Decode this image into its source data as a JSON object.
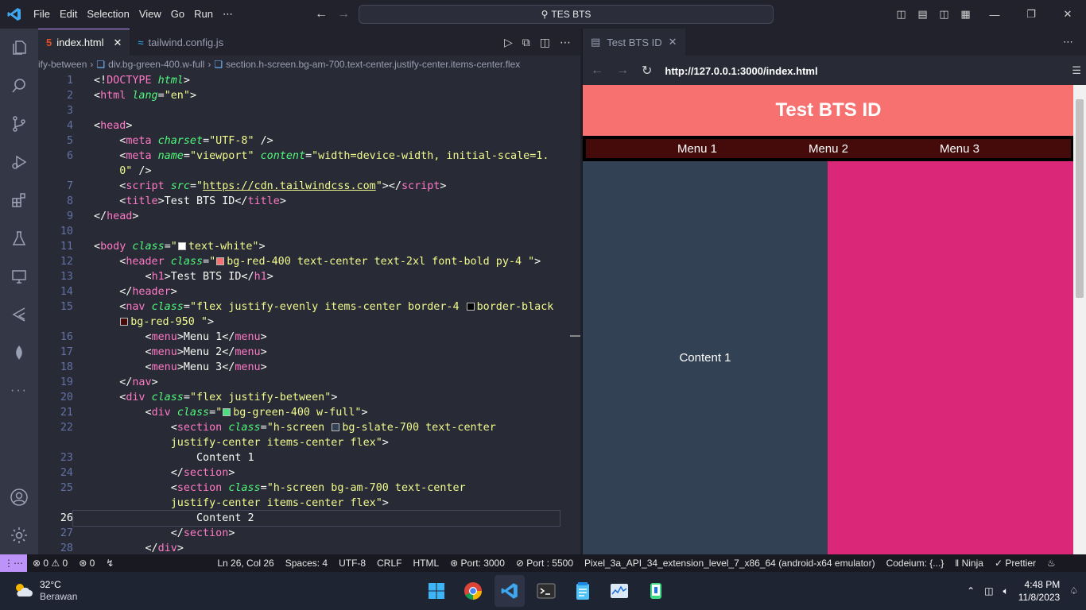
{
  "titlebar": {
    "menu": [
      "File",
      "Edit",
      "Selection",
      "View",
      "Go",
      "Run",
      "⋯"
    ],
    "search": "TES BTS"
  },
  "activity": [
    "files-icon",
    "search-icon",
    "source-control-icon",
    "run-debug-icon",
    "extensions-icon",
    "testing-icon",
    "remote-explorer-icon",
    "tailwind-icon",
    "mongodb-icon",
    "more-icon"
  ],
  "editor": {
    "tabs": [
      {
        "label": "index.html",
        "active": true
      },
      {
        "label": "tailwind.config.js",
        "active": false
      }
    ],
    "breadcrumb": [
      "ify-between",
      "div.bg-green-400.w-full",
      "section.h-screen.bg-am-700.text-center.justify-center.items-center.flex"
    ],
    "line_numbers": [
      "1",
      "2",
      "3",
      "4",
      "5",
      "6",
      "",
      "7",
      "8",
      "9",
      "10",
      "11",
      "12",
      "13",
      "14",
      "15",
      "",
      "16",
      "17",
      "18",
      "19",
      "20",
      "21",
      "22",
      "",
      "23",
      "24",
      "25",
      "",
      "26",
      "27",
      "28"
    ],
    "current_line": "26"
  },
  "preview": {
    "tab": "Test BTS ID",
    "url": "http://127.0.0.1:3000/index.html",
    "site": {
      "header": "Test BTS ID",
      "menu": [
        "Menu 1",
        "Menu 2",
        "Menu 3"
      ],
      "content1": "Content 1"
    }
  },
  "statusbar": {
    "errors": "0",
    "warnings": "0",
    "ports": "0",
    "position": "Ln 26, Col 26",
    "spaces": "Spaces: 4",
    "encoding": "UTF-8",
    "eol": "CRLF",
    "language": "HTML",
    "port": "Port: 3000",
    "port2": "Port : 5500",
    "device": "Pixel_3a_API_34_extension_level_7_x86_64 (android-x64 emulator)",
    "codeium": "Codeium: {...}",
    "ninja": "Ninja",
    "prettier": "Prettier"
  },
  "taskbar": {
    "temp": "32°C",
    "weather": "Berawan",
    "time": "4:48 PM",
    "date": "11/8/2023"
  },
  "colors": {
    "header_bg": "#f87171",
    "nav_bg": "#450a0a",
    "content1_bg": "#334155",
    "content2_bg": "#db2777",
    "accent": "#bd93f9"
  }
}
